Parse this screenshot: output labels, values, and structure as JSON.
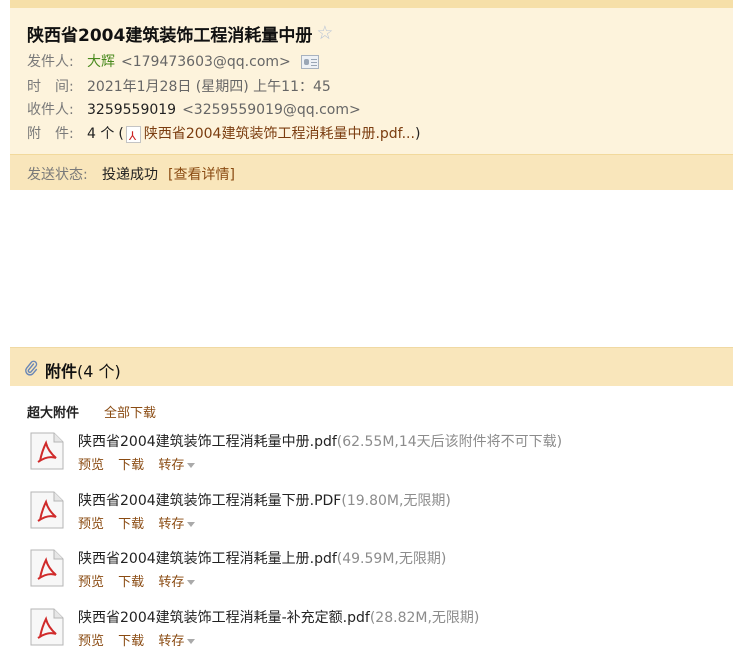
{
  "email": {
    "subject": "陕西省2004建筑装饰工程消耗量中册",
    "star_icon": "star-outline-icon",
    "from": {
      "label": "发件人:",
      "name": "大辉",
      "address": "<179473603@qq.com>"
    },
    "time": {
      "label": "时　间:",
      "value": "2021年1月28日 (星期四) 上午11：45"
    },
    "to": {
      "label": "收件人:",
      "name": "3259559019",
      "address": "<3259559019@qq.com>"
    },
    "attachments_meta": {
      "label": "附　件:",
      "count_text": "4 个",
      "open_paren": "(",
      "first_name": "陕西省2004建筑装饰工程消耗量中册.pdf...",
      "close_paren": ")"
    },
    "status": {
      "label": "发送状态:",
      "value": "投递成功",
      "detail_link": "[查看详情]"
    }
  },
  "attachments_panel": {
    "title": "附件",
    "count_text": "(4 个)",
    "big_attachments_label": "超大附件",
    "download_all": "全部下载",
    "actions": {
      "preview": "预览",
      "download": "下载",
      "save": "转存"
    },
    "files": [
      {
        "name": "陕西省2004建筑装饰工程消耗量中册.pdf",
        "meta": "(62.55M,14天后该附件将不可下载)"
      },
      {
        "name": "陕西省2004建筑装饰工程消耗量下册.PDF",
        "meta": "(19.80M,无限期)"
      },
      {
        "name": "陕西省2004建筑装饰工程消耗量上册.pdf",
        "meta": "(49.59M,无限期)"
      },
      {
        "name": "陕西省2004建筑装饰工程消耗量-补充定额.pdf",
        "meta": "(28.82M,无限期)"
      }
    ]
  },
  "colors": {
    "header_bg": "#fdf3dc",
    "status_bg": "#f9e6bb",
    "link": "#8a4b12",
    "sender_green": "#4a8a1e"
  }
}
